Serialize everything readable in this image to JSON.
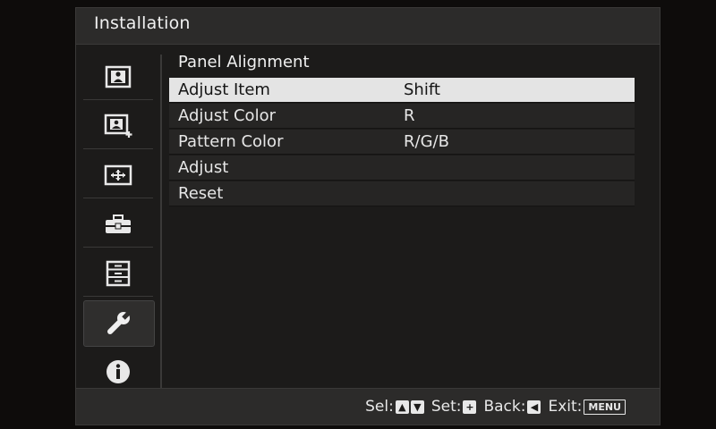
{
  "header": {
    "title": "Installation"
  },
  "sidebar": {
    "items": [
      {
        "icon": "picture-icon"
      },
      {
        "icon": "picture-add-icon"
      },
      {
        "icon": "screen-move-icon"
      },
      {
        "icon": "toolbox-icon"
      },
      {
        "icon": "cabinet-icon"
      },
      {
        "icon": "wrench-icon",
        "selected": true
      },
      {
        "icon": "info-icon"
      }
    ]
  },
  "main": {
    "section_title": "Panel Alignment",
    "rows": [
      {
        "label": "Adjust Item",
        "value": "Shift",
        "selected": true
      },
      {
        "label": "Adjust Color",
        "value": "R"
      },
      {
        "label": "Pattern Color",
        "value": "R/G/B"
      },
      {
        "label": "Adjust",
        "value": ""
      },
      {
        "label": "Reset",
        "value": ""
      }
    ]
  },
  "footer": {
    "sel_label": "Sel:",
    "set_label": "Set:",
    "back_label": "Back:",
    "exit_label": "Exit:",
    "up_key": "▲",
    "down_key": "▼",
    "set_key": "+",
    "back_key": "◀",
    "menu_key": "MENU"
  },
  "colors": {
    "background": "#0e0c0b",
    "panel": "#1c1b1a",
    "titlebar": "#2c2b2a",
    "row": "#262524",
    "selected_row": "#e4e4e4",
    "text": "#e8e8e8"
  }
}
